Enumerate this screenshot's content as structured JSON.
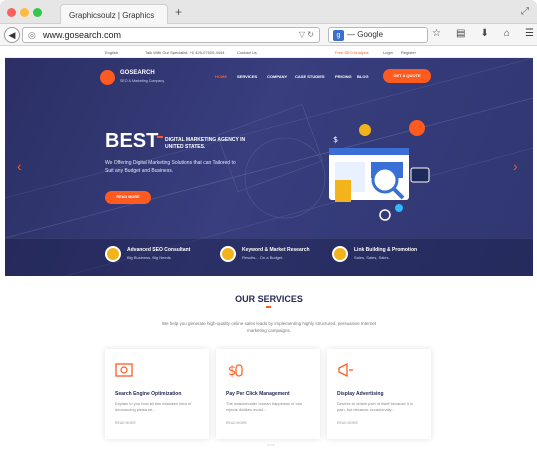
{
  "browser": {
    "tab_title": "Graphicsoulz | Graphics",
    "url": "www.gosearch.com",
    "search_placeholder": "— Google"
  },
  "topbar": {
    "language": "English",
    "talk": "Talk With Our Specialist: +0 425-07520-4444",
    "contact": "Contact Us",
    "seo_analysis": "Free SEO Analysis",
    "login": "Login",
    "register": "Register"
  },
  "site": {
    "logo": "GOSEARCH",
    "logo_sub": "SEO & Marketing Company",
    "menu": [
      "HOME",
      "SERVICES",
      "COMPANY",
      "CASE STUDIES",
      "PRICING",
      "BLOG"
    ],
    "quote_label": "GET A QUOTE"
  },
  "hero": {
    "title": "BEST",
    "headline": "DIGITAL MARKETING AGENCY IN UNITED STATES.",
    "subtext": "We Offering Digital Marketing Solutions that can Tailored to Suit any Budget and Business.",
    "button": "READ MORE"
  },
  "features": [
    {
      "title": "Advanced SEO Consultant",
      "sub": "Big Business, Big Needs"
    },
    {
      "title": "Keyword & Market Research",
      "sub": "Results... On a Budget."
    },
    {
      "title": "Link Building & Promotion",
      "sub": "Sales, Sales, Sales."
    }
  ],
  "services": {
    "title": "OUR SERVICES",
    "desc": "We help you generate high-quality online sales leads by implementing highly structured, persuasive Internet marketing campaigns.",
    "cards": [
      {
        "title": "Search Engine Optimization",
        "text": "Explain to you how all this mistaken idea of denouncing pleasure...",
        "link": "READ MORE"
      },
      {
        "title": "Pay Per Click Management",
        "text": "The mastorbuider human happiness of one rejects dislikes avoid...",
        "link": "READ MORE"
      },
      {
        "title": "Display Advertising",
        "text": "Desires to obtain pain of itself because it is pain, but because occasionally...",
        "link": "READ MORE"
      }
    ]
  },
  "colors": {
    "accent": "#ff5a1f",
    "hero_bg": "#2f3670",
    "title": "#262a55"
  }
}
